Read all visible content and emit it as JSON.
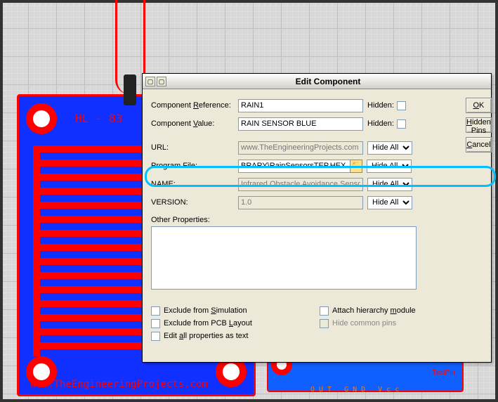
{
  "pcb": {
    "label": "HL - 83",
    "url": "www.TheEngineeringProjects.com"
  },
  "module": {
    "pin_labels": "OUT GND Vcc",
    "testpin": "TestPin"
  },
  "dialog": {
    "title": "Edit Component",
    "labels": {
      "component_reference": "Component Reference:",
      "component_value": "Component Value:",
      "url": "URL:",
      "program_file": "Program File:",
      "name": "NAME:",
      "version": "VERSION:",
      "other_properties": "Other Properties:",
      "hidden": "Hidden:"
    },
    "values": {
      "component_reference": "RAIN1",
      "component_value": "RAIN SENSOR BLUE",
      "url": "www.TheEngineeringProjects.com",
      "program_file": "BRARY\\RainSensorsTEP.HEX",
      "name": "Infrared Obstacle Avoidance Senso",
      "version": "1.0",
      "other_properties": ""
    },
    "visibility_option": "Hide All",
    "buttons": {
      "ok": "OK",
      "hidden_pins": "Hidden Pins",
      "cancel": "Cancel"
    },
    "checkboxes": {
      "exclude_sim": "Exclude from Simulation",
      "exclude_pcb": "Exclude from PCB Layout",
      "edit_all": "Edit all properties as text",
      "attach_hierarchy": "Attach hierarchy module",
      "hide_common": "Hide common pins"
    }
  }
}
